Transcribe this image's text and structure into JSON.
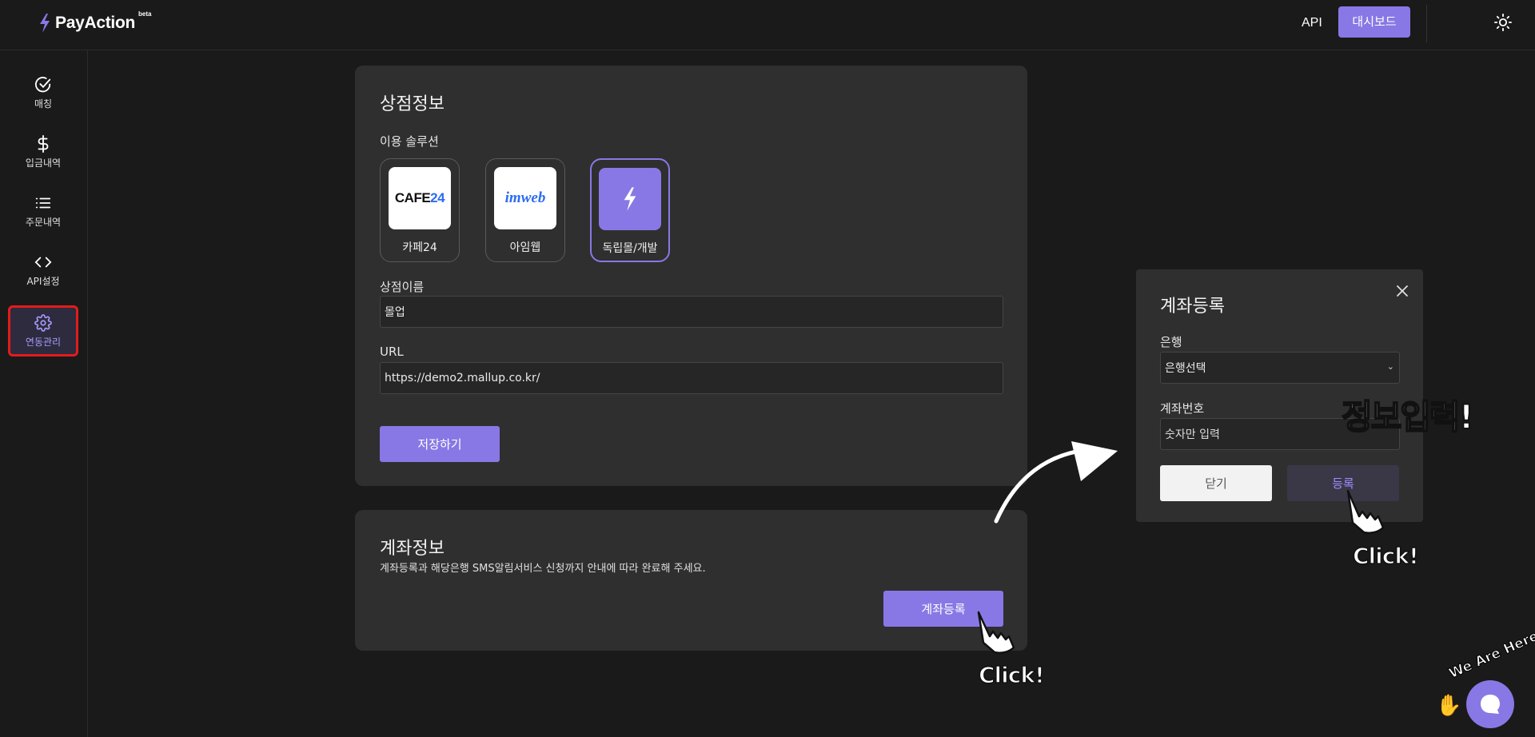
{
  "header": {
    "logo_text": "PayAction",
    "logo_badge": "beta",
    "nav_api": "API",
    "nav_dashboard": "대시보드",
    "theme_icon": "sun-icon"
  },
  "sidebar": {
    "items": [
      {
        "label": "매칭",
        "icon": "check-circle-icon"
      },
      {
        "label": "입금내역",
        "icon": "dollar-icon"
      },
      {
        "label": "주문내역",
        "icon": "list-icon"
      },
      {
        "label": "API설정",
        "icon": "code-icon"
      },
      {
        "label": "연동관리",
        "icon": "gear-icon",
        "active": true
      }
    ]
  },
  "store_card": {
    "title": "상점정보",
    "solutions_label": "이용 솔루션",
    "solutions": [
      {
        "name": "카페24",
        "logo": "CAFE24"
      },
      {
        "name": "아임웹",
        "logo": "imweb"
      },
      {
        "name": "독립몰/개발",
        "logo": "bolt-icon",
        "selected": true
      }
    ],
    "store_name_label": "상점이름",
    "store_name_value": "몰업",
    "url_label": "URL",
    "url_value": "https://demo2.mallup.co.kr/",
    "save_button": "저장하기"
  },
  "account_card": {
    "title": "계좌정보",
    "description": "계좌등록과 해당은행 SMS알림서비스 신청까지 안내에 따라 완료해 주세요.",
    "register_button": "계좌등록"
  },
  "modal": {
    "title": "계좌등록",
    "bank_label": "은행",
    "bank_selected": "은행선택",
    "account_label": "계좌번호",
    "account_placeholder": "숫자만 입력",
    "close_button": "닫기",
    "register_button": "등록"
  },
  "annotations": {
    "click_1": "Click!",
    "click_2": "Click!",
    "info_input": "정보입력!"
  },
  "chat": {
    "banner": "We Are Here!"
  },
  "colors": {
    "accent": "#8878e5",
    "background": "#1a1a1a",
    "card": "#2f2f2f",
    "highlight_box": "#e31b1b"
  }
}
